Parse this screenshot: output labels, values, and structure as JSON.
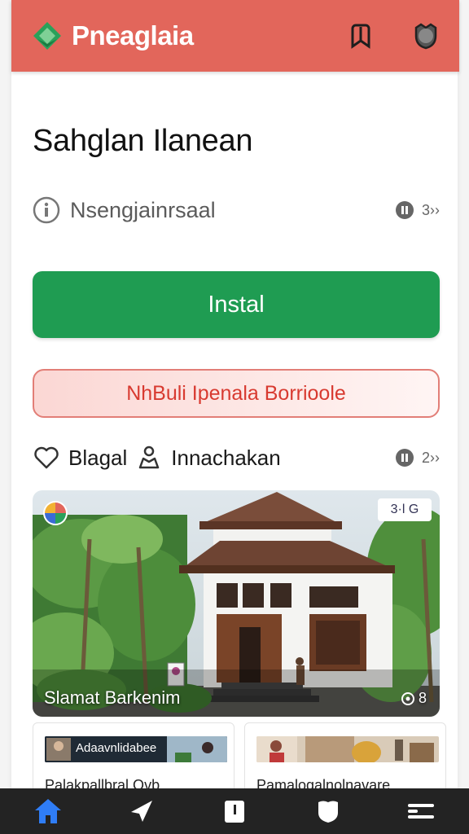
{
  "header": {
    "title": "Pneaglaia",
    "logo_icon": "diamond-logo-icon",
    "icons": [
      "bookmark-icon",
      "heart-shield-icon"
    ],
    "bg_color": "#e2665b"
  },
  "main": {
    "title": "Sahglan Ilanean",
    "meta": {
      "icon": "info-icon",
      "text": "Nsengjainrsaal",
      "badge_count": "3››"
    },
    "install_button": {
      "label": "Instal",
      "color": "#1f9c52"
    },
    "secondary_button": {
      "label": "NhBuli Ipenala Borrioole",
      "color": "#d83a30"
    },
    "actions": {
      "like_label": "Blagal",
      "share_label": "Innachakan",
      "badge_count": "2››"
    },
    "hero": {
      "caption": "Slamat Barkenim",
      "tag": "3·l G",
      "counter": "8"
    },
    "cards": [
      {
        "banner_text": "Adaavnlidabee",
        "title": "Palakpallbral Ovb"
      },
      {
        "banner_text": "",
        "title": "Pamalogalnolnavare"
      }
    ]
  },
  "bottom_nav": {
    "items": [
      "home-icon",
      "send-icon",
      "clipboard-icon",
      "shield-icon",
      "menu-icon"
    ],
    "active_color": "#2f7df6"
  }
}
